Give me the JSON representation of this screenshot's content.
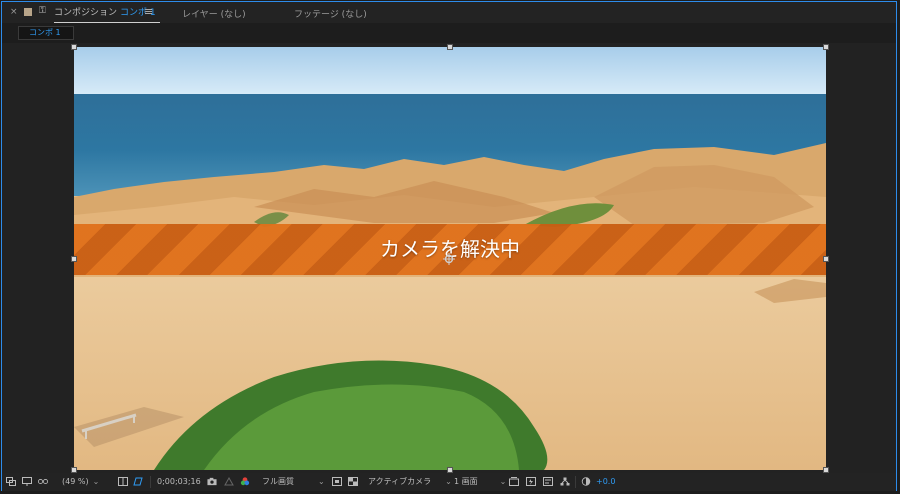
{
  "tabs": {
    "close": "×",
    "composition_label": "コンポジション",
    "composition_name": "コンポ 1",
    "menu": "≡",
    "layer": "レイヤー (なし)",
    "footage": "フッテージ (なし)"
  },
  "subtab": {
    "label": "コンポ 1"
  },
  "overlay": {
    "message": "カメラを解決中"
  },
  "toolbar": {
    "zoom": "(49 %)",
    "timecode": "0;00;03;16",
    "resolution": "フル画質",
    "camera": "アクティブカメラ",
    "views": "1 画面",
    "exposure": "+0.0"
  },
  "colors": {
    "accent": "#2f9cf5",
    "banner": "#e0701a",
    "border": "#2d8ceb"
  }
}
